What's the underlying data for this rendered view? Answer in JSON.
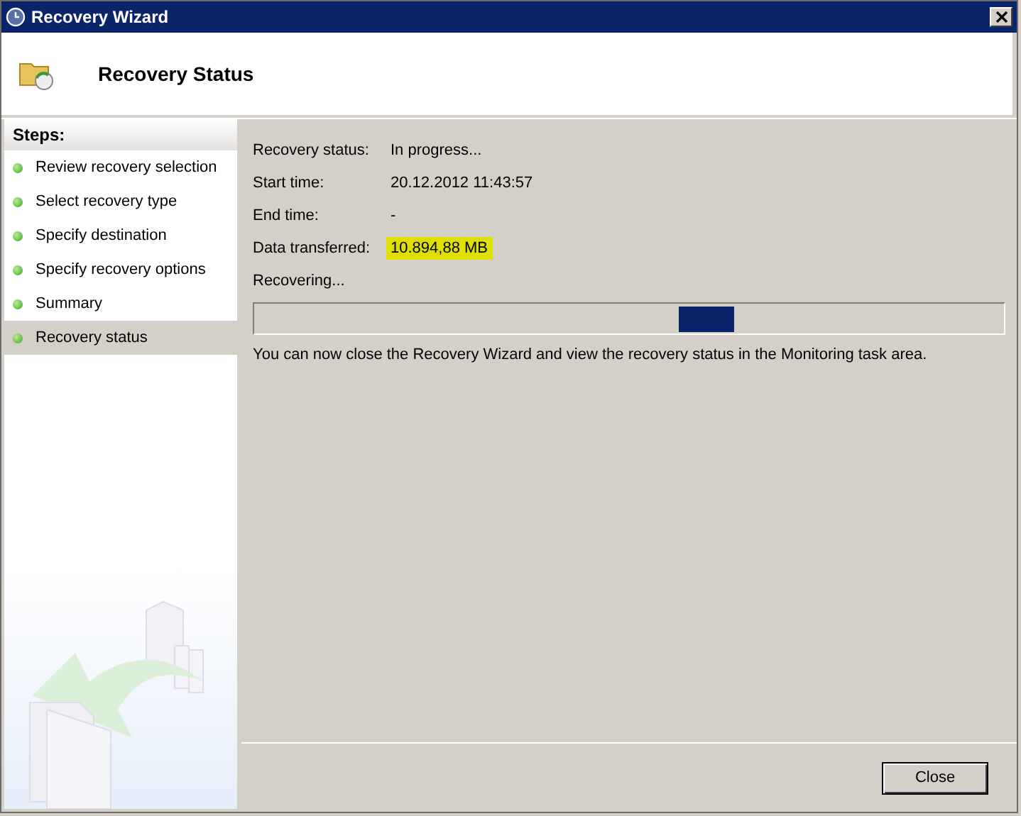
{
  "window": {
    "title": "Recovery Wizard"
  },
  "header": {
    "title": "Recovery Status"
  },
  "steps": {
    "heading": "Steps:",
    "items": [
      {
        "label": "Review recovery selection",
        "selected": false
      },
      {
        "label": "Select recovery type",
        "selected": false
      },
      {
        "label": "Specify destination",
        "selected": false
      },
      {
        "label": "Specify recovery options",
        "selected": false
      },
      {
        "label": "Summary",
        "selected": false
      },
      {
        "label": "Recovery status",
        "selected": true
      }
    ]
  },
  "details": [
    {
      "label": "Recovery status:",
      "value": "In progress...",
      "highlighted": false
    },
    {
      "label": "Start time:",
      "value": "20.12.2012 11:43:57",
      "highlighted": false
    },
    {
      "label": "End time:",
      "value": "-",
      "highlighted": false
    },
    {
      "label": "Data transferred:",
      "value": "10.894,88 MB",
      "highlighted": true
    }
  ],
  "progress": {
    "label": "Recovering...",
    "level": 0.64
  },
  "message": "You can now close the Recovery Wizard and view the recovery status in the Monitoring task area.",
  "buttons": [
    "Close"
  ]
}
